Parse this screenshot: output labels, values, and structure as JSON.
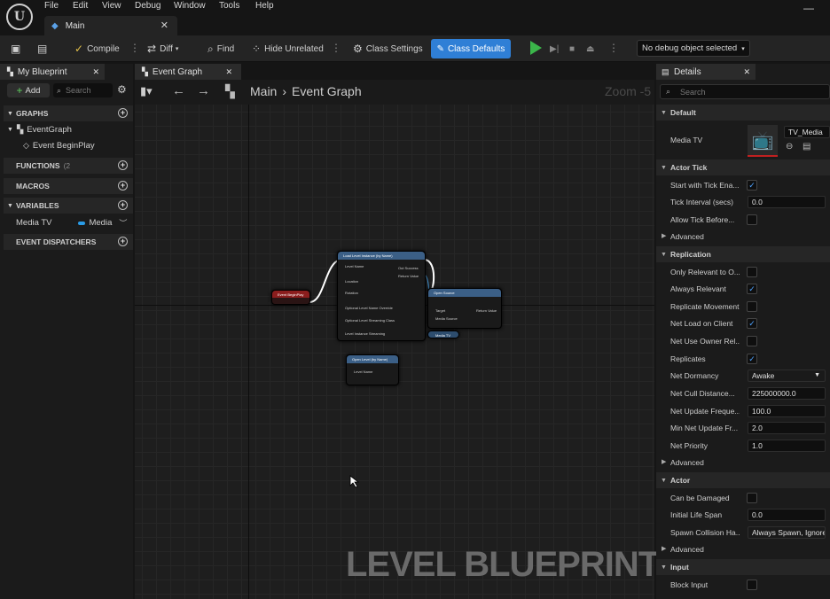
{
  "menu": [
    "File",
    "Edit",
    "View",
    "Debug",
    "Window",
    "Tools",
    "Help"
  ],
  "document_tab": {
    "label": "Main"
  },
  "toolbar": {
    "compile": "Compile",
    "diff": "Diff",
    "find": "Find",
    "hide_unrelated": "Hide Unrelated",
    "class_settings": "Class Settings",
    "class_defaults": "Class Defaults",
    "debug_object": "No debug object selected"
  },
  "my_blueprint": {
    "tab": "My Blueprint",
    "add": "Add",
    "search_placeholder": "Search",
    "sections": {
      "graphs": "GRAPHS",
      "functions": "FUNCTIONS",
      "functions_count": "(2",
      "macros": "MACROS",
      "variables": "VARIABLES",
      "event_dispatchers": "EVENT DISPATCHERS"
    },
    "graph_items": [
      "EventGraph",
      "Event BeginPlay"
    ],
    "variable": {
      "name": "Media TV",
      "type": "Media"
    }
  },
  "graph": {
    "tab": "Event Graph",
    "breadcrumb_root": "Main",
    "breadcrumb_current": "Event Graph",
    "zoom": "Zoom -5",
    "watermark": "LEVEL BLUEPRINT",
    "nodes": {
      "begin_play": "Event BeginPlay",
      "load_level": "Load Level Instance (by Name)",
      "load_pins": [
        "Level Name",
        "Location",
        "Rotation",
        "Optional Level Name Override",
        "Optional Level Streaming Class",
        "Level Instance Streaming",
        "Out Success",
        "Return Value"
      ],
      "open_source": "Open Source",
      "open_pins": [
        "Target",
        "Media Source",
        "Return Value"
      ],
      "media_tv": "Media TV",
      "open_level": "Open Level (by Name)",
      "open_level_pins": [
        "Level Name"
      ]
    }
  },
  "details": {
    "tab": "Details",
    "search_placeholder": "Search",
    "default": {
      "label": "Default",
      "media_tv_label": "Media TV",
      "media_tv_value": "TV_Media"
    },
    "actor_tick": {
      "label": "Actor Tick",
      "start_with_tick": "Start with Tick Ena...",
      "start_with_tick_checked": true,
      "tick_interval": "Tick Interval (secs)",
      "tick_interval_value": "0.0",
      "allow_tick_before": "Allow Tick Before...",
      "allow_tick_checked": false,
      "advanced": "Advanced"
    },
    "replication": {
      "label": "Replication",
      "rows": [
        {
          "label": "Only Relevant to O...",
          "type": "check",
          "checked": false
        },
        {
          "label": "Always Relevant",
          "type": "check",
          "checked": true
        },
        {
          "label": "Replicate Movement",
          "type": "check",
          "checked": false
        },
        {
          "label": "Net Load on Client",
          "type": "check",
          "checked": true
        },
        {
          "label": "Net Use Owner Rel...",
          "type": "check",
          "checked": false
        },
        {
          "label": "Replicates",
          "type": "check",
          "checked": true
        },
        {
          "label": "Net Dormancy",
          "type": "select",
          "value": "Awake"
        },
        {
          "label": "Net Cull Distance...",
          "type": "input",
          "value": "225000000.0"
        },
        {
          "label": "Net Update Freque...",
          "type": "input",
          "value": "100.0"
        },
        {
          "label": "Min Net Update Fr...",
          "type": "input",
          "value": "2.0"
        },
        {
          "label": "Net Priority",
          "type": "input",
          "value": "1.0"
        }
      ],
      "advanced": "Advanced"
    },
    "actor": {
      "label": "Actor",
      "can_be_damaged": "Can be Damaged",
      "can_be_damaged_checked": false,
      "initial_life_span": "Initial Life Span",
      "initial_life_span_value": "0.0",
      "spawn_collision": "Spawn Collision Ha...",
      "spawn_collision_value": "Always Spawn, Ignore C",
      "advanced": "Advanced"
    },
    "input": {
      "label": "Input",
      "block_input": "Block Input",
      "block_input_checked": false
    }
  }
}
